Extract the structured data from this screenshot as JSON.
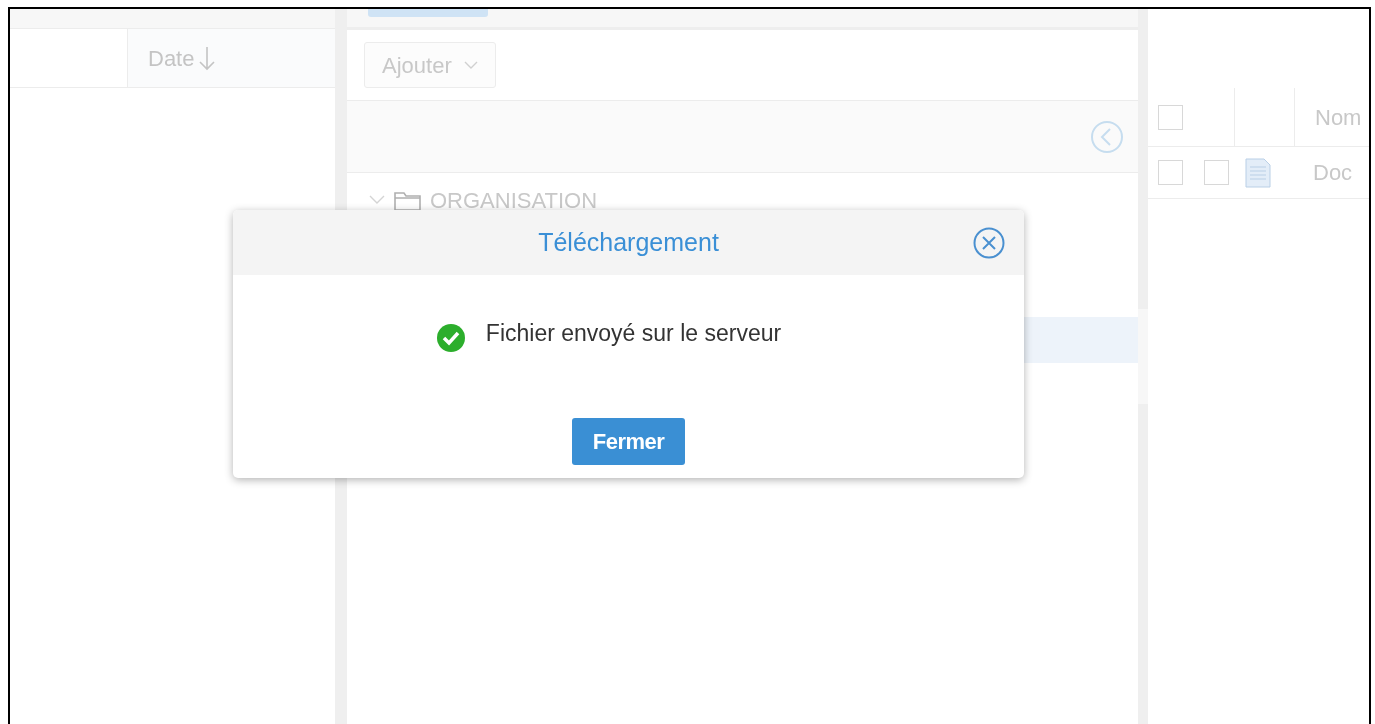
{
  "left_table": {
    "columns": [
      {
        "label": "Date",
        "sort_descending": true
      }
    ]
  },
  "toolbar": {
    "add_button": {
      "label": "Ajouter"
    }
  },
  "tree": {
    "items": [
      {
        "label": "ORGANISATION",
        "expanded": true
      }
    ]
  },
  "file_table": {
    "header_checked": false,
    "columns": [
      {
        "label": "Nom"
      }
    ],
    "rows": [
      {
        "checked": false,
        "marked": false,
        "kind": "document",
        "name": "Doc"
      }
    ]
  },
  "dialog": {
    "title": "Téléchargement",
    "kind": "success",
    "message": "Fichier envoyé sur le serveur",
    "button": "Fermer"
  }
}
